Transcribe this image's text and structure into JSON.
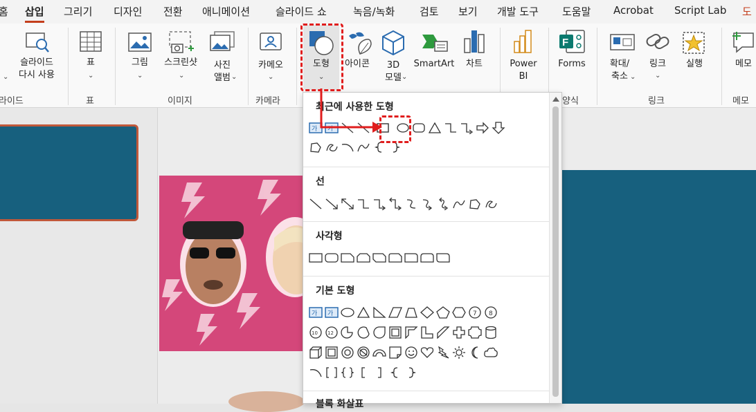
{
  "menu": {
    "tabs": [
      "홈",
      "삽입",
      "그리기",
      "디자인",
      "전환",
      "애니메이션",
      "슬라이드 쇼",
      "녹음/녹화",
      "검토",
      "보기",
      "개발 도구",
      "도움말",
      "Acrobat",
      "Script Lab",
      "도"
    ],
    "active": "삽입"
  },
  "ribbon": {
    "slides": {
      "line1": "슬라이드",
      "line2": "다시 사용",
      "group": "라이드"
    },
    "table": {
      "label": "표",
      "group": "표"
    },
    "images": {
      "picture": "그림",
      "screenshot": "스크린샷",
      "album_line1": "사진",
      "album_line2": "앨범",
      "group": "이미지"
    },
    "camera": {
      "label": "카메오",
      "group": "카메라"
    },
    "shapes": {
      "label": "도형"
    },
    "icons": {
      "label": "아이콘"
    },
    "model3d": {
      "line1": "3D",
      "line2": "모델"
    },
    "smartart": {
      "label": "SmartArt"
    },
    "chart": {
      "label": "차트"
    },
    "powerbi": {
      "line1": "Power",
      "line2": "BI"
    },
    "forms": {
      "label": "Forms",
      "group": "양식"
    },
    "zoom": {
      "line1": "확대/",
      "line2": "축소"
    },
    "link": {
      "label": "링크"
    },
    "action": {
      "label": "실행",
      "group": "링크"
    },
    "memo": {
      "label": "메모",
      "group": "메모"
    }
  },
  "dropdown": {
    "recent": "최근에 사용한 도형",
    "lines": "선",
    "rectangles": "사각형",
    "basic": "기본 도형",
    "arrows": "블록 화살표"
  },
  "colors": {
    "accent": "#c43e1c",
    "highlight": "#e01d1d",
    "slide_bg": "#17607e",
    "photo_bg": "#d4477a"
  }
}
